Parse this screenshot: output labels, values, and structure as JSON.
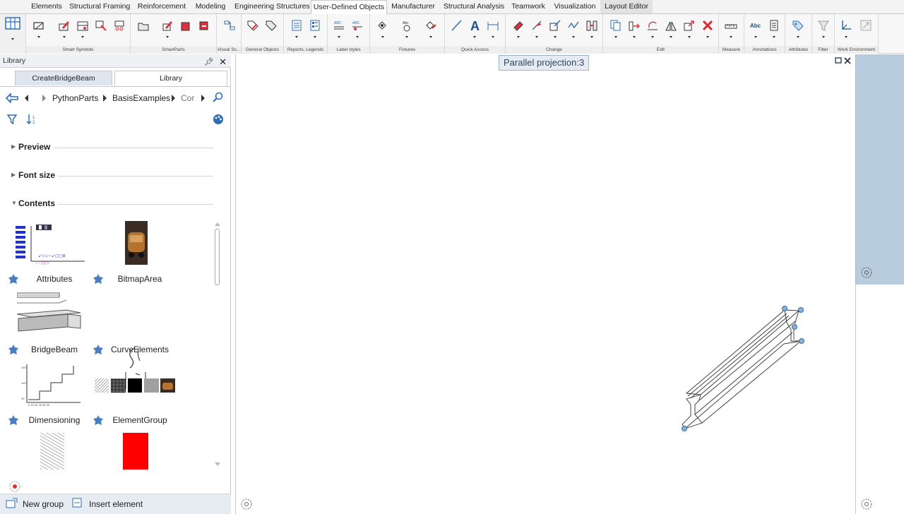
{
  "ribbon": {
    "tabs": [
      {
        "label": "Elements"
      },
      {
        "label": "Structural Framing"
      },
      {
        "label": "Reinforcement"
      },
      {
        "label": "Modeling"
      },
      {
        "label": "Engineering Structures"
      },
      {
        "label": "User-Defined Objects"
      },
      {
        "label": "Manufacturer"
      },
      {
        "label": "Structural Analysis"
      },
      {
        "label": "Teamwork"
      },
      {
        "label": "Visualization"
      },
      {
        "label": "Layout Editor"
      }
    ],
    "groups": [
      {
        "label": "Smart Symbols"
      },
      {
        "label": "SmartParts"
      },
      {
        "label": "Visual Sc..."
      },
      {
        "label": "General Objects"
      },
      {
        "label": "Reports, Legends"
      },
      {
        "label": "Label styles"
      },
      {
        "label": "Fixtures"
      },
      {
        "label": "Quick Access"
      },
      {
        "label": "Change"
      },
      {
        "label": "Edit"
      },
      {
        "label": "Measure"
      },
      {
        "label": "Annotations"
      },
      {
        "label": "Attributes"
      },
      {
        "label": "Filter"
      },
      {
        "label": "Work Environment"
      }
    ],
    "icon_text_abc": "ABC",
    "icon_text_abc_small": "Abc",
    "quick_access_text": "A",
    "annotations_text": "Abc"
  },
  "library": {
    "title": "Library",
    "tabs": [
      {
        "label": "CreateBridgeBeam"
      },
      {
        "label": "Library"
      }
    ],
    "breadcrumb": [
      "PythonParts",
      "BasisExamples",
      "Cor"
    ],
    "sections": {
      "preview": "Preview",
      "font_size": "Font size",
      "contents": "Contents"
    },
    "items": [
      {
        "label": "Attributes"
      },
      {
        "label": "BitmapArea"
      },
      {
        "label": "BridgeBeam"
      },
      {
        "label": "CurveElements"
      },
      {
        "label": "Dimensioning"
      },
      {
        "label": "ElementGroup"
      }
    ],
    "footer": {
      "new_group": "New group",
      "insert_element": "Insert element"
    }
  },
  "viewport": {
    "projection_label": "Parallel projection:3"
  },
  "colors": {
    "accent_blue": "#2e6db4",
    "panel_tab_bg": "#dde6ef",
    "right_pane": "#b8ccdf",
    "element_group_red": "#ff0000"
  }
}
